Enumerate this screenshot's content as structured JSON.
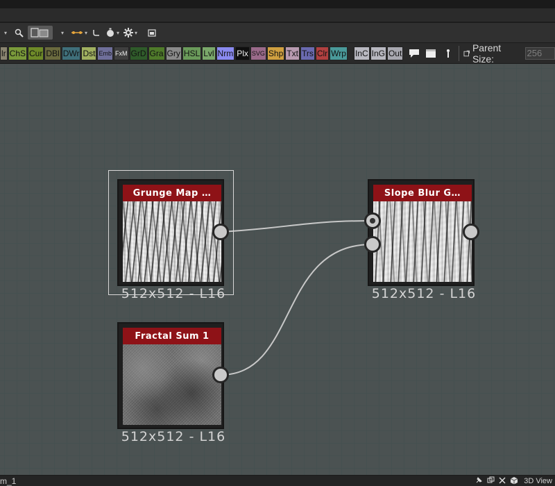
{
  "toolbar": {
    "icons": [
      "dropdown-caret",
      "zoom-icon",
      "align-grid-icon",
      "connector-style-icon",
      "curved-link-icon",
      "timer-icon",
      "settings-gear-icon",
      "frame-view-icon"
    ]
  },
  "palette": {
    "chips": [
      {
        "label": "lr",
        "color": "#8a8470"
      },
      {
        "label": "ChS",
        "color": "#7a9a3a"
      },
      {
        "label": "Cur",
        "color": "#6e8a28"
      },
      {
        "label": "DBl",
        "color": "#6a6a3e"
      },
      {
        "label": "DWr",
        "color": "#3f6f7a"
      },
      {
        "label": "Dst",
        "color": "#a0b060"
      },
      {
        "label": "Emb",
        "color": "#6f6f9a"
      },
      {
        "label": "FxM",
        "color": "#3f3f3f"
      },
      {
        "label": "GrD",
        "color": "#2f5a2a"
      },
      {
        "label": "Gra",
        "color": "#4f7a2a"
      },
      {
        "label": "Gry",
        "color": "#8a8a8a"
      },
      {
        "label": "HSL",
        "color": "#6a9a5a"
      },
      {
        "label": "Lvl",
        "color": "#7aa86a"
      },
      {
        "label": "Nrm",
        "color": "#8a8af0"
      },
      {
        "label": "Plx",
        "color": "#0f0f0f"
      },
      {
        "label": "SVG",
        "color": "#9a6a8a"
      },
      {
        "label": "Shp",
        "color": "#d0a040"
      },
      {
        "label": "Txt",
        "color": "#b89ab0"
      },
      {
        "label": "Trs",
        "color": "#6a6ab0"
      },
      {
        "label": "Clr",
        "color": "#b04040"
      },
      {
        "label": "Wrp",
        "color": "#4a9a9a"
      },
      {
        "label": "InC",
        "color": "#b8b8c0"
      },
      {
        "label": "InG",
        "color": "#b8b8c0"
      },
      {
        "label": "Out",
        "color": "#a8a8b0"
      }
    ],
    "parent_size_label": "Parent Size:",
    "parent_size_value": "256"
  },
  "nodes": {
    "grunge": {
      "title": "Grunge Map …",
      "size": "512x512 - L16"
    },
    "slope": {
      "title": "Slope Blur G…",
      "size": "512x512 - L16"
    },
    "fractal": {
      "title": "Fractal Sum 1",
      "size": "512x512 - L16"
    }
  },
  "statusbar": {
    "left_text": "m_1",
    "view3d_label": "3D View"
  },
  "colors": {
    "node_title": "#8e1217",
    "canvas_bg": "#4b5252",
    "wire": "#c8c8c8"
  }
}
